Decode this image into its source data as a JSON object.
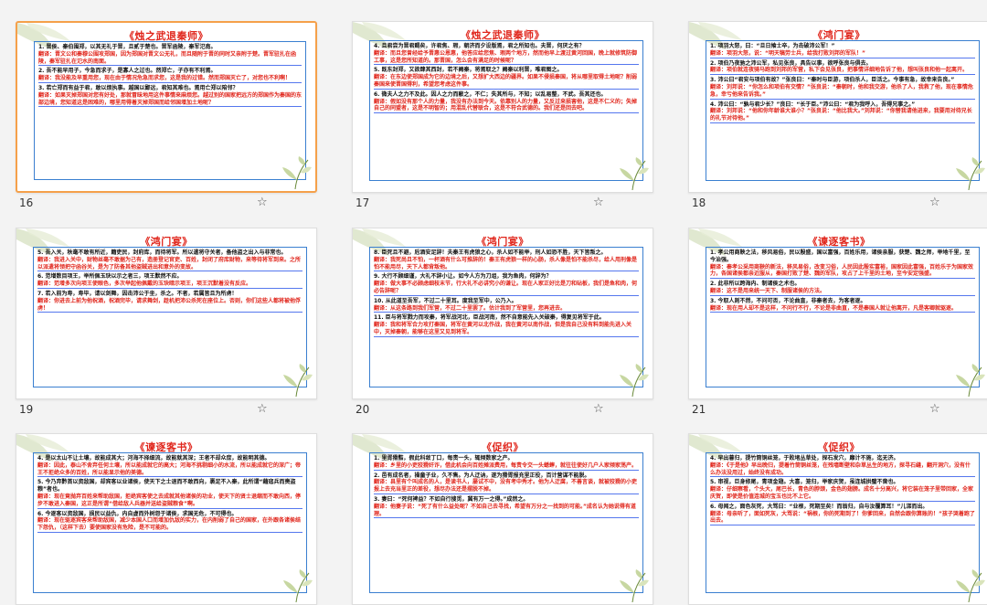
{
  "slides": [
    {
      "number": "16",
      "title": "《烛之武退秦师》",
      "selected": true,
      "lines": [
        {
          "t": "q",
          "text": "1. 晋侯、秦伯围郑，以其无礼于晋，且贰于楚也。晋军函陵，秦军氾南。"
        },
        {
          "t": "a",
          "text": "翻译：晋文公和秦穆公围攻郑国，因为郑国对晋文公无礼，而且随附于晋的同时又亲附于楚。晋军驻扎在函陵，秦军驻扎在氾水的南面。"
        },
        {
          "t": "q",
          "text": "2. 吾不能早用子，今急而求子，是寡人之过也。然郑亡，子亦有不利焉。"
        },
        {
          "t": "a",
          "text": "翻译：我没能及早重用您，现在由于情况危急而求您，这是我的过错。然而郑国灭亡了，对您也不利啊！"
        },
        {
          "t": "q",
          "text": "3. 若亡郑而有益于君，敢以烦执事。越国以鄙远，君知其难也。焉用亡郑以陪邻？"
        },
        {
          "t": "a",
          "text": "翻译：如果灭掉郑国对您有好处，那就冒昧地用这件事情来麻烦您。越过别的国家把远方的郑国作为秦国的东部边境，您知道这是困难的，哪里用得着灭掉郑国而给邻国增加土地呢？"
        }
      ]
    },
    {
      "number": "17",
      "title": "《烛之武退秦师》",
      "selected": false,
      "lines": [
        {
          "t": "q",
          "text": "4. 且君尝为晋君赐矣，许君焦、瑕，朝济而夕设版焉，君之所知也。夫晋，何厌之有？"
        },
        {
          "t": "a",
          "text": "翻译：而且您曾经给予晋惠公恩惠，他答应给您焦、瑕两个地方，然而他早上渡过黄河回国，晚上就修筑防御工事，这是您所知道的。那晋国，怎么会有满足的时候呢？"
        },
        {
          "t": "q",
          "text": "5. 既东封郑，又欲肆其西封，若不阙秦，将焉取之？阙秦以利晋，唯君图之。"
        },
        {
          "t": "a",
          "text": "翻译：在东边使郑国成为它的边境之后，又想扩大西边的疆界。如果不侵损秦国，将从哪里取得土地呢？削弱秦国来使晋国得利，希望您考虑这件事。"
        },
        {
          "t": "q",
          "text": "6. 微夫人之力不及此。因人之力而敝之，不仁；失其所与，不知；以乱易整，不武。吾其还也。"
        },
        {
          "t": "a",
          "text": "翻译：假如没有那个人的力量，我没有办法到今天。依靠别人的力量，又反过来损害他，这是不仁义的；失掉自己的同盟者，这是不明智的；用混乱代替联合，这是不符合武德的。我们还是回去吧。"
        }
      ]
    },
    {
      "number": "18",
      "title": "《鸿门宴》",
      "selected": false,
      "lines": [
        {
          "t": "q",
          "text": "1. 项羽大怒，曰：“旦日飨士卒，为击破沛公军！”"
        },
        {
          "t": "a",
          "text": "翻译：项羽大怒，说：“明天犒劳士兵，给我打败刘邦的军队！”"
        },
        {
          "t": "q",
          "text": "2. 项伯乃夜驰之沛公军，私见张良，具告以事，欲呼张良与俱去。"
        },
        {
          "t": "a",
          "text": "翻译：项伯就连夜骑马跑到刘邦的军营，私下会见张良，把事情详细地告诉了他，想叫张良和他一起离开。"
        },
        {
          "t": "q",
          "text": "3. 沛公曰“君安与项伯有故？”张良曰：“秦时与臣游，项伯杀人，臣活之。今事有急，故幸来告良。”"
        },
        {
          "t": "a",
          "text": "翻译：刘邦说：“你怎么和项伯有交情？”张良说：“秦朝时，他和我交游，他杀了人，我救了他，现在事情危急，幸亏他来告诉我。”"
        },
        {
          "t": "q",
          "text": "4. 沛公曰：“孰与君少长？”良曰：“长于臣。”沛公曰：“君为我呼入，吾得兄事之。”"
        },
        {
          "t": "a",
          "text": "翻译：刘邦说：“他和你年龄谁大谁小？”张良说：“他比我大。”刘邦说：“你替我请他进来，我要用对待兄长的礼节对待他。”"
        }
      ]
    },
    {
      "number": "19",
      "title": "《鸿门宴》",
      "selected": false,
      "lines": [
        {
          "t": "q",
          "text": "5. 吾入关，秋毫不敢有所近，籍吏民，封府库，而待将军。所以遣将守关者，备他盗之出入与非常也。"
        },
        {
          "t": "a",
          "text": "翻译：我进入关中，财物丝毫不敢据为己有，造册登记官吏、百姓，封闭了府库财物，来等待将军到来。之所以派遣将领把守函谷关，是为了防备其他盗贼进出和意外的变故。"
        },
        {
          "t": "q",
          "text": "6. 范增数目项王，举所佩玉玦以示之者三，项王默然不应。"
        },
        {
          "t": "a",
          "text": "翻译：范增多次向项王使眼色，多次举起他佩戴的玉玦暗示项王，项王沉默着没有反应。"
        },
        {
          "t": "q",
          "text": "7. 若入前为寿，寿毕，请以剑舞，因击沛公于坐，杀之。不者，若属皆且为所虏！"
        },
        {
          "t": "a",
          "text": "翻译：你进去上前为他祝酒，祝酒完毕，请求舞剑，趁机把沛公杀死在座位上。否则，你们这些人都将被他俘虏！"
        }
      ]
    },
    {
      "number": "20",
      "title": "《鸿门宴》",
      "selected": false,
      "lines": [
        {
          "t": "q",
          "text": "8. 臣死且不避，卮酒安足辞！夫秦王有虎狼之心，杀人如不能举，刑人如恐不胜，天下皆叛之。"
        },
        {
          "t": "a",
          "text": "翻译：我死尚且不怕，一杯酒有什么可推辞的！秦王有虎狼一样的心肠，杀人像是怕不能杀尽，给人用刑像是怕不能用尽，天下人都背叛他。"
        },
        {
          "t": "q",
          "text": "9. 大行不顾细谨，大礼不辞小让。如今人方为刀俎，我为鱼肉，何辞为？"
        },
        {
          "t": "a",
          "text": "翻译：做大事不必顾虑细枝末节，行大礼不必讲究小的谦让。现在人家正好比是刀和砧板，我们是鱼和肉，何必告辞呢？"
        },
        {
          "t": "q",
          "text": "10. 从此道至吾军，不过二十里耳。度我至军中，公乃入。"
        },
        {
          "t": "a",
          "text": "翻译：从这条路到我们军营，不过二十里罢了。估计我到了军营里，您再进去。"
        },
        {
          "t": "q",
          "text": "11. 臣与将军戮力而攻秦，将军战河北，臣战河南，然不自意能先入关破秦，得复见将军于此。"
        },
        {
          "t": "a",
          "text": "翻译：我和将军合力攻打秦国，将军在黄河以北作战，我在黄河以南作战，但是我自己没有料到能先进入关中，灭掉秦朝，能够在这里又见到将军。"
        }
      ]
    },
    {
      "number": "21",
      "title": "《谏逐客书》",
      "selected": false,
      "lines": [
        {
          "t": "q",
          "text": "1. 孝公用商鞅之法，移风易俗，民以殷盛，国以富强，百姓乐用，诸侯亲服，获楚、魏之师，举地千里，至今治强。"
        },
        {
          "t": "a",
          "text": "翻译：秦孝公采用商鞅的新法，移风易俗，改变习俗，人民因此殷实富裕，国家因此富强，百姓乐于为国家效力，各国诸侯都亲近服从，秦国打败了楚、魏的军队，攻占了上千里的土地，至今安定强盛。"
        },
        {
          "t": "q",
          "text": "2. 此非所以跨海内、制诸侯之术也。"
        },
        {
          "t": "a",
          "text": "翻译：这不是用来统一天下、制服诸侯的方法。"
        },
        {
          "t": "q",
          "text": "3. 今取人则不然，不问可否，不论曲直，非秦者去，为客者逐。"
        },
        {
          "t": "a",
          "text": "翻译：现在用人却不是这样，不问行不行，不论是非曲直，不是秦国人就让他离开，凡是客卿就驱逐。"
        }
      ]
    },
    {
      "number": "",
      "title": "《谏逐客书》",
      "selected": false,
      "lines": [
        {
          "t": "q",
          "text": "4. 是以太山不让土壤，故能成其大；河海不择细流，故能就其深；王者不却众庶，故能明其德。"
        },
        {
          "t": "a",
          "text": "翻译：因此，泰山不舍弃任何土壤，所以能成就它的高大；河海不挑剔细小的水流，所以能成就它的深广；帝王不拒绝众多的百姓，所以能显示他的美德。"
        },
        {
          "t": "q",
          "text": "5. 今乃弃黔首以资敌国，却宾客以业诸侯，使天下之士退而不敢西向，裹足不入秦，此所谓“藉寇兵而赍盗粮”者也。"
        },
        {
          "t": "a",
          "text": "翻译：现在竟抛弃百姓来帮助敌国，拒绝宾客使之去成就其他诸侯的功业，使天下的贤士退缩而不敢向西，停步不敢进入秦国，这正是所谓“借给敌人兵器并送给盗贼粮食”啊。"
        },
        {
          "t": "q",
          "text": "6. 今逐客以资敌国，损民以益仇，内自虚而外树怨于诸侯，求国无危，不可得也。"
        },
        {
          "t": "a",
          "text": "翻译：现在驱逐宾客来帮助敌国，减少本国人口而增加仇敌的实力，在内削弱了自己的国家，在外跟各诸侯结下怨仇，（这样下去）要使国家没有危险，是不可能的。"
        }
      ]
    },
    {
      "number": "",
      "title": "《促织》",
      "selected": false,
      "lines": [
        {
          "t": "q",
          "text": "1. 里胥猾黠，假此科敛丁口，每责一头，辄倾数家之产。"
        },
        {
          "t": "a",
          "text": "翻译：乡里的小吏狡猾奸诈，借此机会向百姓摊派费用，每责令交一头蟋蟀，就往往使好几户人家倾家荡产。"
        },
        {
          "t": "q",
          "text": "2. 邑有成名者，操童子业，久不售。为人迂讷，遂为猾胥报充里正役，百计营谋不能脱。"
        },
        {
          "t": "a",
          "text": "翻译：县里有个叫成名的人，是读书人，屡试不中，没有考中秀才。他为人迂腐，不善言谈，就被狡猾的小吏报上去充当里正的差役，想尽办法还是摆脱不掉。"
        },
        {
          "t": "q",
          "text": "3. 妻曰：“死何裨益？不如自行搜觅，冀有万一之得。”成然之。"
        },
        {
          "t": "a",
          "text": "翻译：他妻子说：“死了有什么益处呢？不如自己去寻找，希望有万分之一找到的可能。”成名认为她说得有道理。"
        }
      ]
    },
    {
      "number": "",
      "title": "《促织》",
      "selected": false,
      "lines": [
        {
          "t": "q",
          "text": "4. 早出暮归，提竹筒铜丝笼，于败堵丛草处，探石发穴，靡计不施，迄无济。"
        },
        {
          "t": "a",
          "text": "翻译：《于是他》早出晚归，提着竹筒铜丝笼，在残墙断壁和杂草丛生的地方，探寻石缝，翻开洞穴，没有什么办法没用过，始终没有成功。"
        },
        {
          "t": "q",
          "text": "5. 审视，巨身修尾，青项金翅。大喜，笼归，举家庆贺，虽连城拱璧不啻也。"
        },
        {
          "t": "a",
          "text": "翻译：仔细察看，个头大，尾巴长，青色的脖颈，金色的翅膀。成名十分高兴，将它装在笼子里带回家，全家庆贺，即使是价值连城的宝玉也比不上它。"
        },
        {
          "t": "q",
          "text": "6. 母闻之，面色灰死，大骂曰：“业根，死期至矣！而翁归，自与汝覆算耳！”儿涕而出。"
        },
        {
          "t": "a",
          "text": "翻译：母亲听了，面如死灰，大骂说：“祸根，你的死期到了！你爹回来，自然会跟你算账的！”孩子哭着跑了出去。"
        }
      ]
    }
  ]
}
